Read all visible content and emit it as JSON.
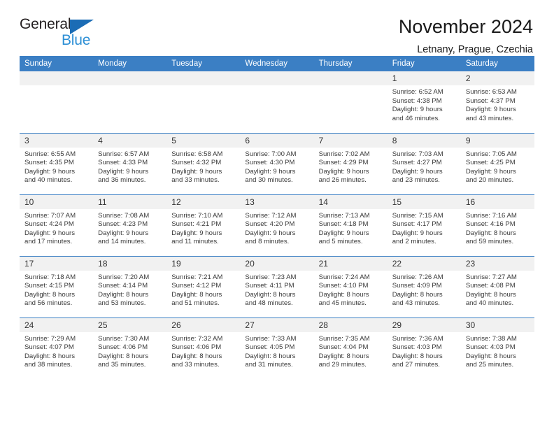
{
  "brand": {
    "name_top": "General",
    "name_bottom": "Blue",
    "accent_dark": "#1b6cb5",
    "accent_light": "#2d8fd5"
  },
  "header": {
    "title": "November 2024",
    "subtitle": "Letnany, Prague, Czechia"
  },
  "theme": {
    "header_blue": "#3b7fc4",
    "daynum_bg": "#f1f1f1",
    "text": "#3a3a3a"
  },
  "weekdays": [
    "Sunday",
    "Monday",
    "Tuesday",
    "Wednesday",
    "Thursday",
    "Friday",
    "Saturday"
  ],
  "weeks": [
    [
      {
        "day": "",
        "empty": true
      },
      {
        "day": "",
        "empty": true
      },
      {
        "day": "",
        "empty": true
      },
      {
        "day": "",
        "empty": true
      },
      {
        "day": "",
        "empty": true
      },
      {
        "day": "1",
        "sunrise": "Sunrise: 6:52 AM",
        "sunset": "Sunset: 4:38 PM",
        "daylight1": "Daylight: 9 hours",
        "daylight2": "and 46 minutes."
      },
      {
        "day": "2",
        "sunrise": "Sunrise: 6:53 AM",
        "sunset": "Sunset: 4:37 PM",
        "daylight1": "Daylight: 9 hours",
        "daylight2": "and 43 minutes."
      }
    ],
    [
      {
        "day": "3",
        "sunrise": "Sunrise: 6:55 AM",
        "sunset": "Sunset: 4:35 PM",
        "daylight1": "Daylight: 9 hours",
        "daylight2": "and 40 minutes."
      },
      {
        "day": "4",
        "sunrise": "Sunrise: 6:57 AM",
        "sunset": "Sunset: 4:33 PM",
        "daylight1": "Daylight: 9 hours",
        "daylight2": "and 36 minutes."
      },
      {
        "day": "5",
        "sunrise": "Sunrise: 6:58 AM",
        "sunset": "Sunset: 4:32 PM",
        "daylight1": "Daylight: 9 hours",
        "daylight2": "and 33 minutes."
      },
      {
        "day": "6",
        "sunrise": "Sunrise: 7:00 AM",
        "sunset": "Sunset: 4:30 PM",
        "daylight1": "Daylight: 9 hours",
        "daylight2": "and 30 minutes."
      },
      {
        "day": "7",
        "sunrise": "Sunrise: 7:02 AM",
        "sunset": "Sunset: 4:29 PM",
        "daylight1": "Daylight: 9 hours",
        "daylight2": "and 26 minutes."
      },
      {
        "day": "8",
        "sunrise": "Sunrise: 7:03 AM",
        "sunset": "Sunset: 4:27 PM",
        "daylight1": "Daylight: 9 hours",
        "daylight2": "and 23 minutes."
      },
      {
        "day": "9",
        "sunrise": "Sunrise: 7:05 AM",
        "sunset": "Sunset: 4:25 PM",
        "daylight1": "Daylight: 9 hours",
        "daylight2": "and 20 minutes."
      }
    ],
    [
      {
        "day": "10",
        "sunrise": "Sunrise: 7:07 AM",
        "sunset": "Sunset: 4:24 PM",
        "daylight1": "Daylight: 9 hours",
        "daylight2": "and 17 minutes."
      },
      {
        "day": "11",
        "sunrise": "Sunrise: 7:08 AM",
        "sunset": "Sunset: 4:23 PM",
        "daylight1": "Daylight: 9 hours",
        "daylight2": "and 14 minutes."
      },
      {
        "day": "12",
        "sunrise": "Sunrise: 7:10 AM",
        "sunset": "Sunset: 4:21 PM",
        "daylight1": "Daylight: 9 hours",
        "daylight2": "and 11 minutes."
      },
      {
        "day": "13",
        "sunrise": "Sunrise: 7:12 AM",
        "sunset": "Sunset: 4:20 PM",
        "daylight1": "Daylight: 9 hours",
        "daylight2": "and 8 minutes."
      },
      {
        "day": "14",
        "sunrise": "Sunrise: 7:13 AM",
        "sunset": "Sunset: 4:18 PM",
        "daylight1": "Daylight: 9 hours",
        "daylight2": "and 5 minutes."
      },
      {
        "day": "15",
        "sunrise": "Sunrise: 7:15 AM",
        "sunset": "Sunset: 4:17 PM",
        "daylight1": "Daylight: 9 hours",
        "daylight2": "and 2 minutes."
      },
      {
        "day": "16",
        "sunrise": "Sunrise: 7:16 AM",
        "sunset": "Sunset: 4:16 PM",
        "daylight1": "Daylight: 8 hours",
        "daylight2": "and 59 minutes."
      }
    ],
    [
      {
        "day": "17",
        "sunrise": "Sunrise: 7:18 AM",
        "sunset": "Sunset: 4:15 PM",
        "daylight1": "Daylight: 8 hours",
        "daylight2": "and 56 minutes."
      },
      {
        "day": "18",
        "sunrise": "Sunrise: 7:20 AM",
        "sunset": "Sunset: 4:14 PM",
        "daylight1": "Daylight: 8 hours",
        "daylight2": "and 53 minutes."
      },
      {
        "day": "19",
        "sunrise": "Sunrise: 7:21 AM",
        "sunset": "Sunset: 4:12 PM",
        "daylight1": "Daylight: 8 hours",
        "daylight2": "and 51 minutes."
      },
      {
        "day": "20",
        "sunrise": "Sunrise: 7:23 AM",
        "sunset": "Sunset: 4:11 PM",
        "daylight1": "Daylight: 8 hours",
        "daylight2": "and 48 minutes."
      },
      {
        "day": "21",
        "sunrise": "Sunrise: 7:24 AM",
        "sunset": "Sunset: 4:10 PM",
        "daylight1": "Daylight: 8 hours",
        "daylight2": "and 45 minutes."
      },
      {
        "day": "22",
        "sunrise": "Sunrise: 7:26 AM",
        "sunset": "Sunset: 4:09 PM",
        "daylight1": "Daylight: 8 hours",
        "daylight2": "and 43 minutes."
      },
      {
        "day": "23",
        "sunrise": "Sunrise: 7:27 AM",
        "sunset": "Sunset: 4:08 PM",
        "daylight1": "Daylight: 8 hours",
        "daylight2": "and 40 minutes."
      }
    ],
    [
      {
        "day": "24",
        "sunrise": "Sunrise: 7:29 AM",
        "sunset": "Sunset: 4:07 PM",
        "daylight1": "Daylight: 8 hours",
        "daylight2": "and 38 minutes."
      },
      {
        "day": "25",
        "sunrise": "Sunrise: 7:30 AM",
        "sunset": "Sunset: 4:06 PM",
        "daylight1": "Daylight: 8 hours",
        "daylight2": "and 35 minutes."
      },
      {
        "day": "26",
        "sunrise": "Sunrise: 7:32 AM",
        "sunset": "Sunset: 4:06 PM",
        "daylight1": "Daylight: 8 hours",
        "daylight2": "and 33 minutes."
      },
      {
        "day": "27",
        "sunrise": "Sunrise: 7:33 AM",
        "sunset": "Sunset: 4:05 PM",
        "daylight1": "Daylight: 8 hours",
        "daylight2": "and 31 minutes."
      },
      {
        "day": "28",
        "sunrise": "Sunrise: 7:35 AM",
        "sunset": "Sunset: 4:04 PM",
        "daylight1": "Daylight: 8 hours",
        "daylight2": "and 29 minutes."
      },
      {
        "day": "29",
        "sunrise": "Sunrise: 7:36 AM",
        "sunset": "Sunset: 4:03 PM",
        "daylight1": "Daylight: 8 hours",
        "daylight2": "and 27 minutes."
      },
      {
        "day": "30",
        "sunrise": "Sunrise: 7:38 AM",
        "sunset": "Sunset: 4:03 PM",
        "daylight1": "Daylight: 8 hours",
        "daylight2": "and 25 minutes."
      }
    ]
  ]
}
